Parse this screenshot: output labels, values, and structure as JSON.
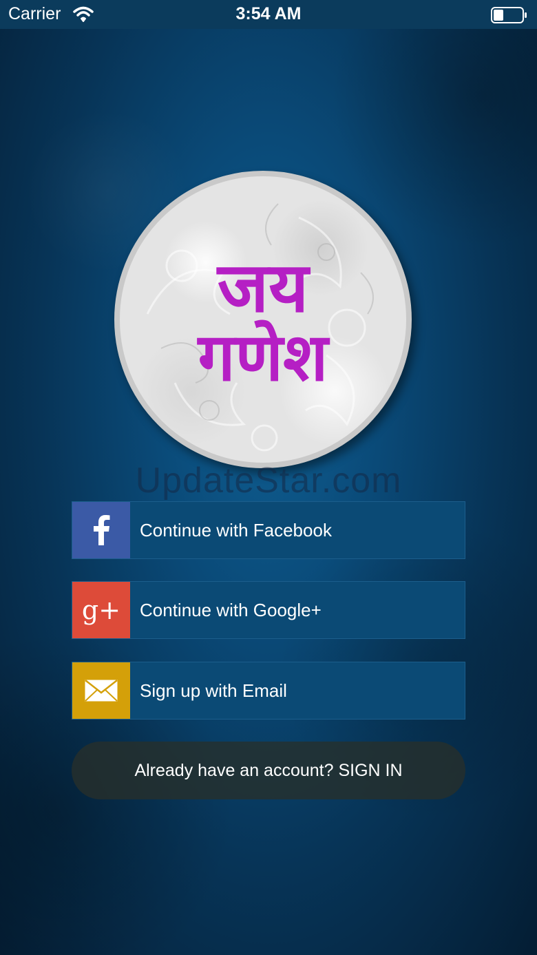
{
  "status_bar": {
    "carrier": "Carrier",
    "time": "3:54 AM",
    "wifi_icon": "wifi-icon",
    "battery_icon": "battery-icon"
  },
  "logo": {
    "line1": "जय",
    "line2": "गणेश",
    "text_color": "#b51fc4"
  },
  "watermark": "UpdateStar.com",
  "auth": {
    "facebook": {
      "label": "Continue with Facebook",
      "icon": "facebook-icon",
      "color": "#3b5aa6"
    },
    "google": {
      "label": "Continue with Google+",
      "icon": "google-plus-icon",
      "icon_text": "g+",
      "color": "#dd4b39"
    },
    "email": {
      "label": "Sign up with Email",
      "icon": "envelope-icon",
      "color": "#d4a009"
    }
  },
  "signin": {
    "label": "Already have an account? SIGN IN"
  }
}
